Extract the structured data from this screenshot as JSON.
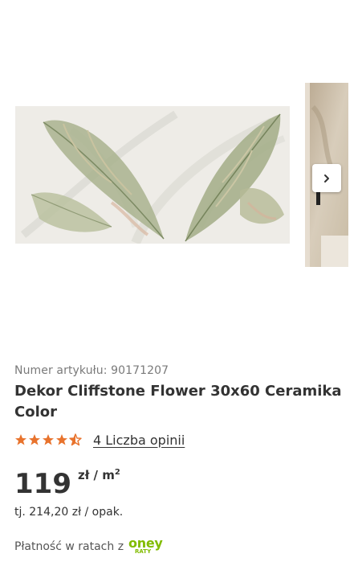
{
  "product": {
    "article_number": "Numer artykułu: 90171207",
    "title": "Dekor Cliffstone Flower 30x60 Ceramika Color",
    "rating": 4.5,
    "rating_max": 5,
    "reviews_link": "4 Liczba opinii",
    "price": {
      "amount": "119",
      "unit": "zł / m",
      "unit_superscript": "2",
      "package_price": "tj. 214,20 zł / opak."
    },
    "installments": {
      "label": "Płatność w ratach z",
      "provider": "oney",
      "provider_sub": "RATY"
    }
  },
  "icons": {
    "next": "chevron-right-icon",
    "star": "star-icon"
  },
  "colors": {
    "star": "#e8732d",
    "oney_green": "#81bc00",
    "text": "#333333",
    "muted": "#7a7a7a"
  }
}
